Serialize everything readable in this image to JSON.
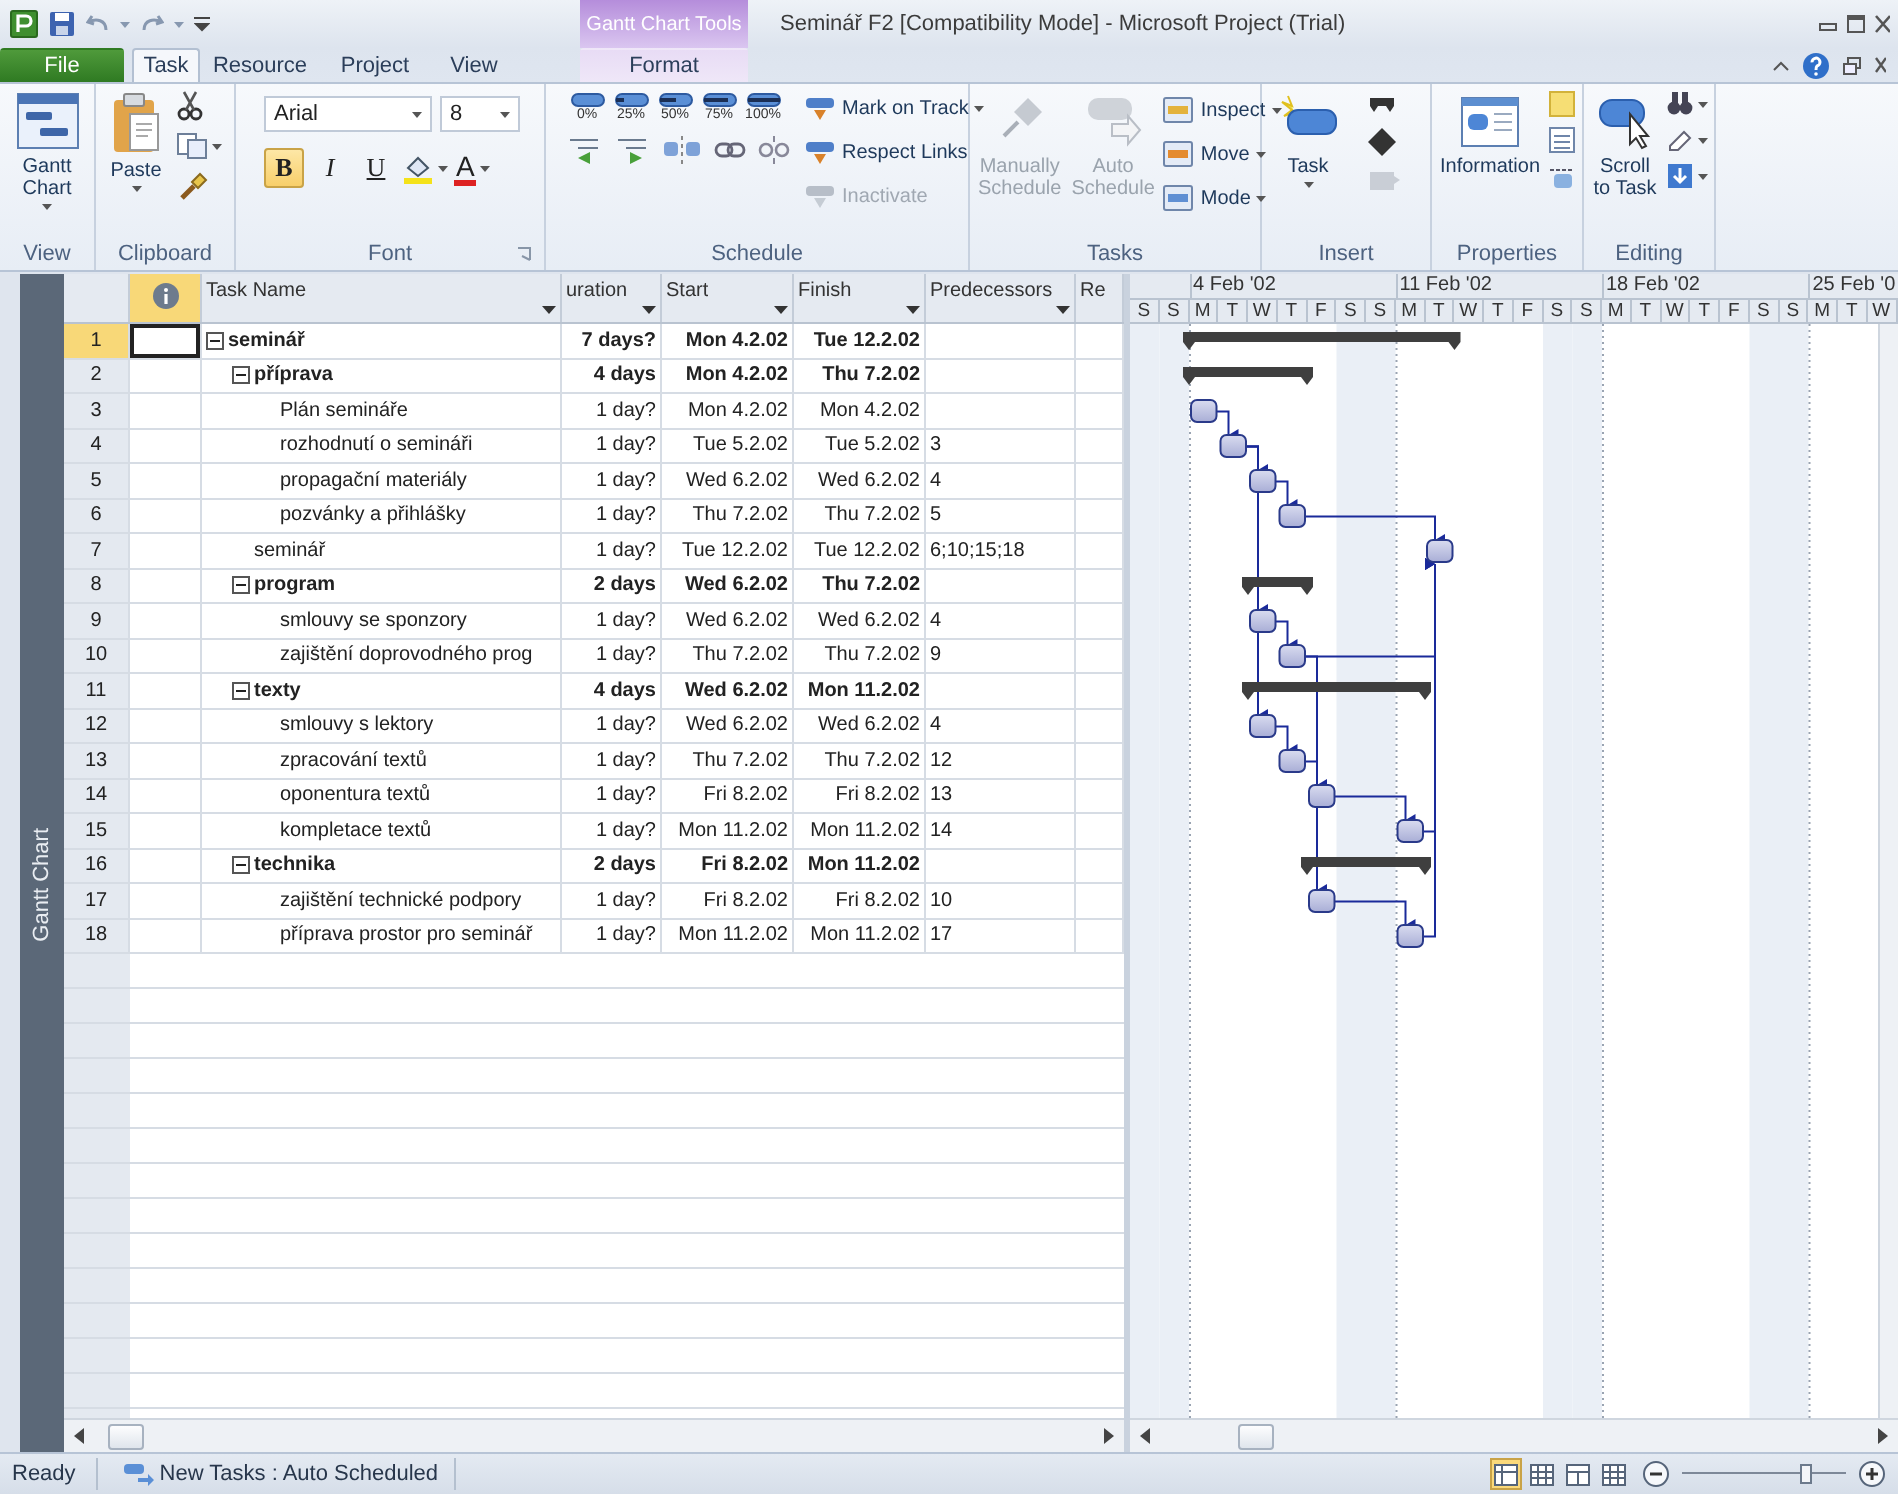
{
  "window": {
    "title": "Seminář F2 [Compatibility Mode] - Microsoft Project (Trial)",
    "contextual_group": "Gantt Chart Tools"
  },
  "tabs": [
    {
      "label": "File",
      "kind": "file",
      "selected": false
    },
    {
      "label": "Task",
      "kind": "normal",
      "selected": true
    },
    {
      "label": "Resource",
      "kind": "normal",
      "selected": false
    },
    {
      "label": "Project",
      "kind": "normal",
      "selected": false
    },
    {
      "label": "View",
      "kind": "normal",
      "selected": false
    },
    {
      "label": "Format",
      "kind": "contextual",
      "selected": false
    }
  ],
  "ribbon": {
    "view": {
      "label": "View",
      "button": "Gantt Chart"
    },
    "clipboard": {
      "label": "Clipboard",
      "button": "Paste"
    },
    "font": {
      "label": "Font",
      "font_name": "Arial",
      "font_size": "8",
      "font_color": "A",
      "styles": [
        {
          "label": "B",
          "kind": "bold",
          "pressed": true
        },
        {
          "label": "I",
          "kind": "italic",
          "pressed": false
        },
        {
          "label": "U",
          "kind": "underline",
          "pressed": false
        }
      ]
    },
    "schedule": {
      "label": "Schedule",
      "progress": [
        "0%",
        "25%",
        "50%",
        "75%",
        "100%"
      ],
      "commands": [
        {
          "label": "Mark on Track",
          "dropdown": true,
          "disabled": false
        },
        {
          "label": "Respect Links",
          "dropdown": false,
          "disabled": false
        },
        {
          "label": "Inactivate",
          "dropdown": false,
          "disabled": true
        }
      ]
    },
    "tasks": {
      "label": "Tasks",
      "modes": [
        {
          "label": "Manually Schedule",
          "disabled": true
        },
        {
          "label": "Auto Schedule",
          "disabled": true
        }
      ],
      "commands": [
        "Inspect",
        "Move",
        "Mode"
      ]
    },
    "insert": {
      "label": "Insert",
      "button": "Task"
    },
    "properties": {
      "label": "Properties",
      "button": "Information"
    },
    "editing": {
      "label": "Editing",
      "button": "Scroll to Task"
    }
  },
  "view_bar": {
    "label": "Gantt Chart"
  },
  "table": {
    "columns": [
      {
        "kind": "indicators",
        "selected": true
      },
      {
        "kind": "name",
        "label": "Task Name",
        "selected": false
      },
      {
        "kind": "duration",
        "label": "uration",
        "selected": false
      },
      {
        "kind": "start",
        "label": "Start",
        "selected": false
      },
      {
        "kind": "finish",
        "label": "Finish",
        "selected": false
      },
      {
        "kind": "predecessors",
        "label": "Predecessors",
        "selected": false
      },
      {
        "kind": "other",
        "label": "Re",
        "selected": false
      }
    ],
    "rows": [
      {
        "id": "1",
        "name": "seminář",
        "kind": "summary",
        "expanded": true,
        "selected": true,
        "duration": "7 days?",
        "start": "Mon 4.2.02",
        "finish": "Tue 12.2.02",
        "children": [
          {
            "id": "2",
            "name": "příprava",
            "kind": "summary",
            "expanded": true,
            "selected": false,
            "duration": "4 days",
            "start": "Mon 4.2.02",
            "finish": "Thu 7.2.02",
            "children": [
              {
                "id": "3",
                "name": "Plán semináře",
                "kind": "task",
                "selected": false,
                "duration": "1 day?",
                "start": "Mon 4.2.02",
                "finish": "Mon 4.2.02"
              },
              {
                "id": "4",
                "name": "rozhodnutí o semináři",
                "kind": "task",
                "selected": false,
                "duration": "1 day?",
                "start": "Tue 5.2.02",
                "finish": "Tue 5.2.02",
                "predecessors": "3"
              },
              {
                "id": "5",
                "name": "propagační materiály",
                "kind": "task",
                "selected": false,
                "duration": "1 day?",
                "start": "Wed 6.2.02",
                "finish": "Wed 6.2.02",
                "predecessors": "4"
              },
              {
                "id": "6",
                "name": "pozvánky a přihlášky",
                "kind": "task",
                "selected": false,
                "duration": "1 day?",
                "start": "Thu 7.2.02",
                "finish": "Thu 7.2.02",
                "predecessors": "5"
              }
            ]
          },
          {
            "id": "7",
            "name": "seminář",
            "kind": "task",
            "selected": false,
            "duration": "1 day?",
            "start": "Tue 12.2.02",
            "finish": "Tue 12.2.02",
            "predecessors": "6;10;15;18"
          },
          {
            "id": "8",
            "name": "program",
            "kind": "summary",
            "expanded": true,
            "selected": false,
            "duration": "2 days",
            "start": "Wed 6.2.02",
            "finish": "Thu 7.2.02",
            "children": [
              {
                "id": "9",
                "name": "smlouvy se sponzory",
                "kind": "task",
                "selected": false,
                "duration": "1 day?",
                "start": "Wed 6.2.02",
                "finish": "Wed 6.2.02",
                "predecessors": "4"
              },
              {
                "id": "10",
                "name": "zajištění doprovodného prog",
                "kind": "task",
                "selected": false,
                "duration": "1 day?",
                "start": "Thu 7.2.02",
                "finish": "Thu 7.2.02",
                "predecessors": "9"
              }
            ]
          },
          {
            "id": "11",
            "name": "texty",
            "kind": "summary",
            "expanded": true,
            "selected": false,
            "duration": "4 days",
            "start": "Wed 6.2.02",
            "finish": "Mon 11.2.02",
            "children": [
              {
                "id": "12",
                "name": "smlouvy s lektory",
                "kind": "task",
                "selected": false,
                "duration": "1 day?",
                "start": "Wed 6.2.02",
                "finish": "Wed 6.2.02",
                "predecessors": "4"
              },
              {
                "id": "13",
                "name": "zpracování textů",
                "kind": "task",
                "selected": false,
                "duration": "1 day?",
                "start": "Thu 7.2.02",
                "finish": "Thu 7.2.02",
                "predecessors": "12"
              },
              {
                "id": "14",
                "name": "oponentura textů",
                "kind": "task",
                "selected": false,
                "duration": "1 day?",
                "start": "Fri 8.2.02",
                "finish": "Fri 8.2.02",
                "predecessors": "13"
              },
              {
                "id": "15",
                "name": "kompletace textů",
                "kind": "task",
                "selected": false,
                "duration": "1 day?",
                "start": "Mon 11.2.02",
                "finish": "Mon 11.2.02",
                "predecessors": "14"
              }
            ]
          },
          {
            "id": "16",
            "name": "technika",
            "kind": "summary",
            "expanded": true,
            "selected": false,
            "duration": "2 days",
            "start": "Fri 8.2.02",
            "finish": "Mon 11.2.02",
            "children": [
              {
                "id": "17",
                "name": "zajištění technické podpory",
                "kind": "task",
                "selected": false,
                "duration": "1 day?",
                "start": "Fri 8.2.02",
                "finish": "Fri 8.2.02",
                "predecessors": "10"
              },
              {
                "id": "18",
                "name": "příprava prostor pro seminář",
                "kind": "task",
                "selected": false,
                "duration": "1 day?",
                "start": "Mon 11.2.02",
                "finish": "Mon 11.2.02",
                "predecessors": "17"
              }
            ]
          }
        ]
      }
    ]
  },
  "timescale": {
    "weeks": [
      "4 Feb '02",
      "11 Feb '02",
      "18 Feb '02",
      "25 Feb '0"
    ],
    "days": [
      "S",
      "S",
      "M",
      "T",
      "W",
      "T",
      "F",
      "S",
      "S",
      "M",
      "T",
      "W",
      "T",
      "F",
      "S",
      "S",
      "M",
      "T",
      "W",
      "T",
      "F",
      "S",
      "S",
      "M",
      "T",
      "W"
    ]
  },
  "status_bar": {
    "status": "Ready",
    "task_mode": "New Tasks : Auto Scheduled",
    "views": [
      {
        "selected": true
      },
      {
        "selected": false
      },
      {
        "selected": false
      },
      {
        "selected": false
      }
    ],
    "zoom": {
      "level": 0.75
    }
  }
}
